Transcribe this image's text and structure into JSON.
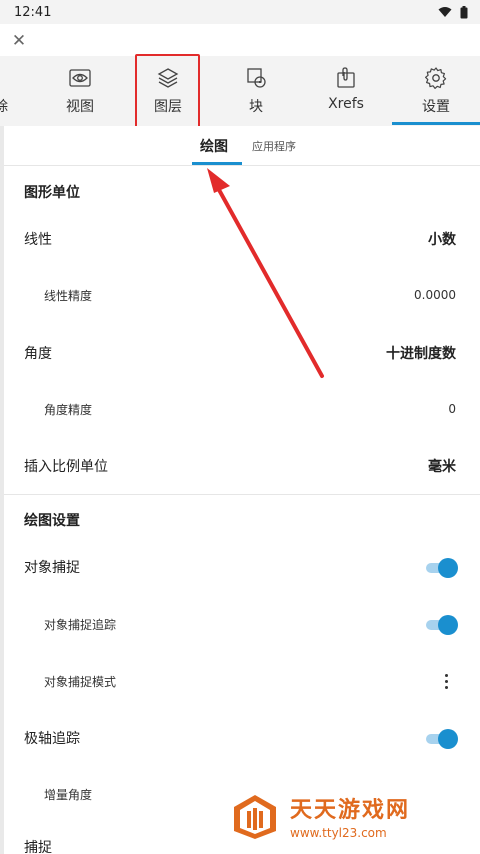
{
  "status_bar": {
    "time": "12:41"
  },
  "tabs": [
    {
      "label": "视图",
      "icon": "eye-icon"
    },
    {
      "label": "图层",
      "icon": "layers-icon"
    },
    {
      "label": "块",
      "icon": "block-icon"
    },
    {
      "label": "Xrefs",
      "icon": "xref-icon"
    },
    {
      "label": "设置",
      "icon": "gear-icon",
      "selected": true
    }
  ],
  "tab_partial_left": "除",
  "subtabs": [
    {
      "label": "绘图",
      "selected": true
    },
    {
      "label": "应用程序"
    }
  ],
  "sections": {
    "units_title": "图形单位",
    "drawing_settings_title": "绘图设置"
  },
  "rows": {
    "linear": {
      "label": "线性",
      "value": "小数"
    },
    "linear_precision": {
      "label": "线性精度",
      "value": "0.0000"
    },
    "angle": {
      "label": "角度",
      "value": "十进制度数"
    },
    "angle_precision": {
      "label": "角度精度",
      "value": "0"
    },
    "insert_units": {
      "label": "插入比例单位",
      "value": "毫米"
    },
    "osnap": {
      "label": "对象捕捉",
      "on": true
    },
    "osnap_tracking": {
      "label": "对象捕捉追踪",
      "on": true
    },
    "osnap_mode": {
      "label": "对象捕捉模式"
    },
    "polar_tracking": {
      "label": "极轴追踪",
      "on": true
    },
    "increment_angle": {
      "label": "增量角度"
    },
    "snap": {
      "label": "捕捉"
    }
  },
  "watermark": {
    "name": "天天游戏网",
    "url": "www.ttyl23.com"
  },
  "colors": {
    "accent": "#1a8fcf",
    "highlight_box": "#e22b2b",
    "watermark": "#e06a1e"
  }
}
